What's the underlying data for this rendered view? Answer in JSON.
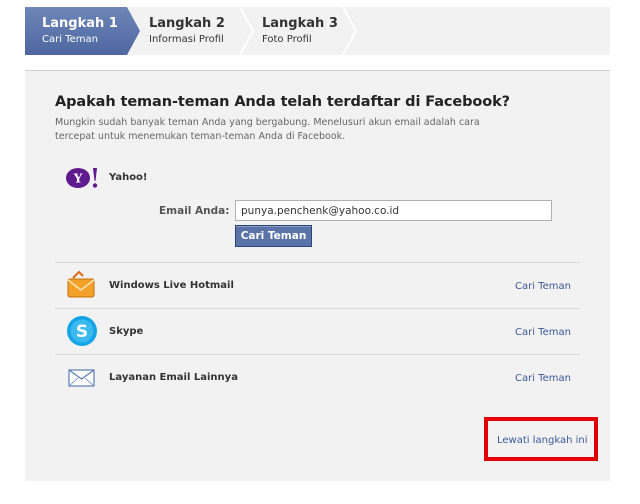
{
  "steps": [
    {
      "title": "Langkah 1",
      "subtitle": "Cari Teman",
      "active": true
    },
    {
      "title": "Langkah 2",
      "subtitle": "Informasi Profil",
      "active": false
    },
    {
      "title": "Langkah 3",
      "subtitle": "Foto Profil",
      "active": false
    }
  ],
  "main": {
    "heading": "Apakah teman-teman Anda telah terdaftar di Facebook?",
    "description": "Mungkin sudah banyak teman Anda yang bergabung. Menelusuri akun email adalah cara tercepat untuk menemukan teman-teman Anda di Facebook."
  },
  "yahoo": {
    "label": "Yahoo!",
    "email_label": "Email Anda:",
    "email_value": "punya.penchenk@yahoo.co.id",
    "button_label": "Cari Teman",
    "icon": "yahoo-logo-icon"
  },
  "providers": [
    {
      "name": "Windows Live Hotmail",
      "link": "Cari Teman",
      "icon": "hotmail-icon"
    },
    {
      "name": "Skype",
      "link": "Cari Teman",
      "icon": "skype-icon"
    },
    {
      "name": "Layanan Email Lainnya",
      "link": "Cari Teman",
      "icon": "envelope-icon"
    }
  ],
  "skip": {
    "label": "Lewati langkah ini"
  },
  "colors": {
    "active_step": "#5b74a8",
    "link": "#3b5998",
    "highlight_box": "#e00000",
    "panel_bg": "#f2f2f2"
  }
}
